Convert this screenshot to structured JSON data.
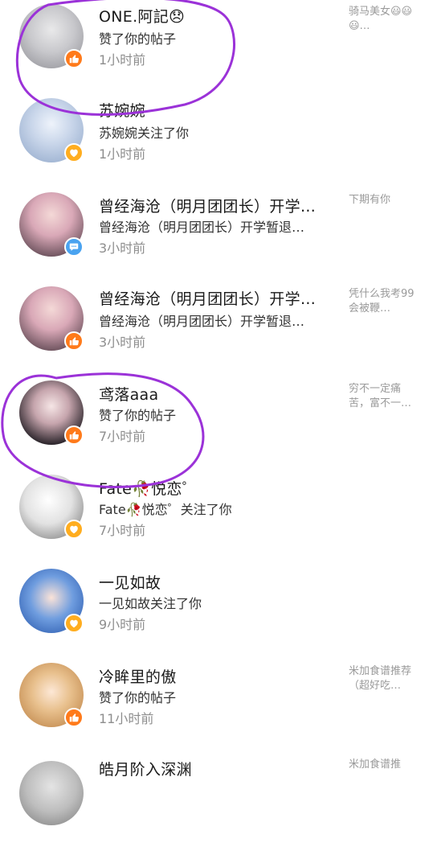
{
  "notifications": [
    {
      "name": "ONE.阿記😞",
      "action": "赞了你的帖子",
      "time": "1小时前",
      "preview": "骑马美女😃😃😃…",
      "type": "like"
    },
    {
      "name": "苏婉婉",
      "action": "苏婉婉关注了你",
      "time": "1小时前",
      "preview": "",
      "type": "follow"
    },
    {
      "name": "曾经海沧（明月团团长）开学…",
      "action": "曾经海沧（明月团团长）开学暂退…",
      "time": "3小时前",
      "preview": "下期有你",
      "type": "comment"
    },
    {
      "name": "曾经海沧（明月团团长）开学…",
      "action": "曾经海沧（明月团团长）开学暂退…",
      "time": "3小时前",
      "preview": "凭什么我考99会被鞭…",
      "type": "like"
    },
    {
      "name": "鸢落aaa",
      "action": "赞了你的帖子",
      "time": "7小时前",
      "preview": "穷不一定痛苦，富不一…",
      "type": "like"
    },
    {
      "name": "Fate🥀悦恋゜",
      "action": "Fate🥀悦恋゜关注了你",
      "time": "7小时前",
      "preview": "",
      "type": "follow"
    },
    {
      "name": "一见如故",
      "action": "一见如故关注了你",
      "time": "9小时前",
      "preview": "",
      "type": "follow"
    },
    {
      "name": "冷眸里的傲",
      "action": "赞了你的帖子",
      "time": "11小时前",
      "preview": "米加食谱推荐（超好吃…",
      "type": "like"
    },
    {
      "name": "皓月阶入深渊",
      "action": "",
      "time": "",
      "preview": "米加食谱推",
      "type": "like"
    }
  ],
  "colors": {
    "like_badge": "#ff7a1a",
    "follow_badge": "#ffad1f",
    "comment_badge": "#4aa3f0",
    "annotation_circle": "#9b32d8"
  },
  "icons": {
    "like": "thumbs-up-icon",
    "follow": "heart-icon",
    "comment": "comment-icon"
  }
}
